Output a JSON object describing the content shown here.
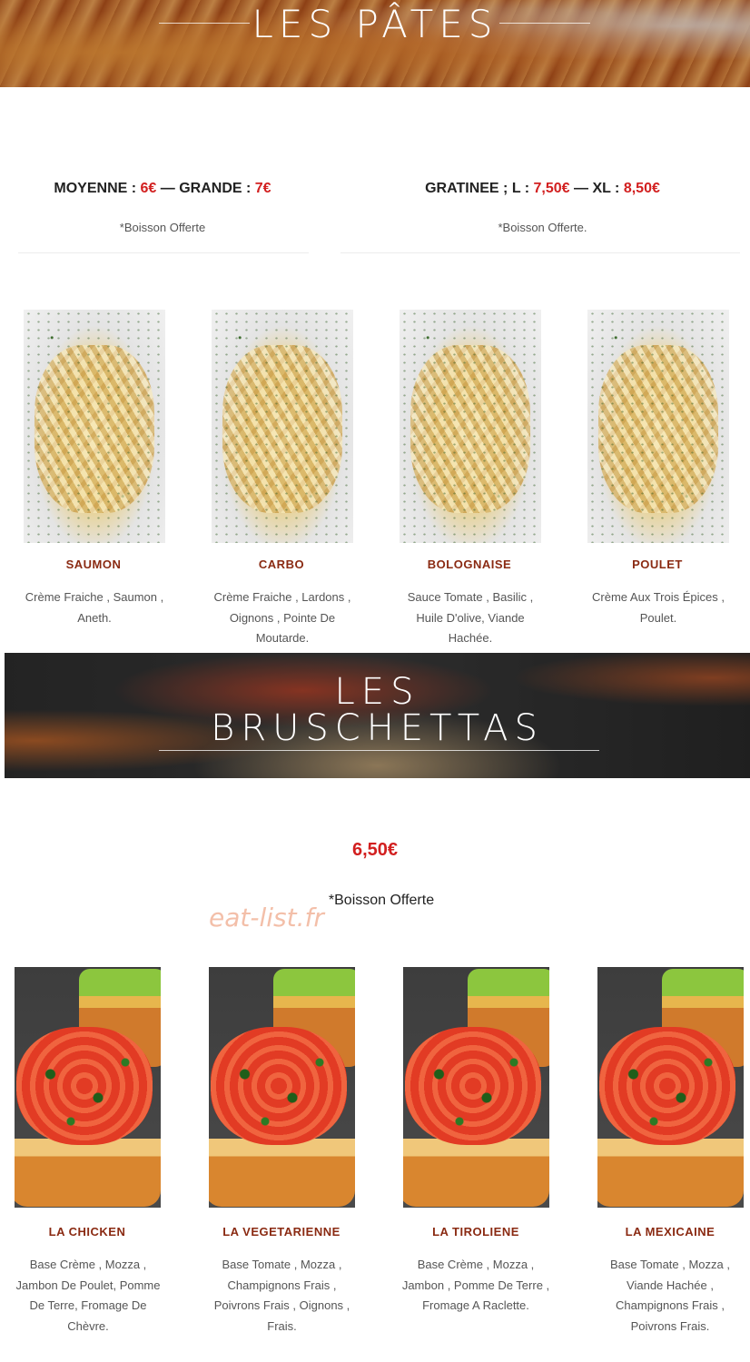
{
  "banners": {
    "pates": "LES PÂTES",
    "bruschettas_line1": "LES",
    "bruschettas_line2": "BRUSCHETTAS"
  },
  "pates_prices": {
    "left": {
      "moyenne_label": "MOYENNE : ",
      "moyenne_price": "6€",
      "sep": " — GRANDE : ",
      "grande_price": "7€",
      "note": "*Boisson Offerte"
    },
    "right": {
      "gratinee_label": "GRATINEE ; L : ",
      "l_price": "7,50€",
      "sep": " — XL : ",
      "xl_price": "8,50€",
      "note": "*Boisson Offerte."
    }
  },
  "pates": [
    {
      "name": "SAUMON",
      "desc": "Crème Fraiche , Saumon , Aneth."
    },
    {
      "name": "CARBO",
      "desc": "Crème Fraiche , Lardons , Oignons , Pointe De Moutarde."
    },
    {
      "name": "BOLOGNAISE",
      "desc": "Sauce Tomate , Basilic , Huile D'olive, Viande Hachée."
    },
    {
      "name": "POULET",
      "desc": "Crème Aux Trois Épices , Poulet."
    }
  ],
  "bruschettas_price": "6,50€",
  "bruschettas_note": "*Boisson Offerte",
  "watermark": "eat-list.fr",
  "bruschettas": [
    {
      "name": "LA CHICKEN",
      "desc": "Base Crème , Mozza , Jambon De Poulet, Pomme De Terre, Fromage De Chèvre."
    },
    {
      "name": "LA VEGETARIENNE",
      "desc": "Base Tomate , Mozza , Champignons Frais , Poivrons Frais , Oignons , Frais."
    },
    {
      "name": "LA TIROLIENE",
      "desc": "Base Crème , Mozza , Jambon , Pomme De Terre , Fromage A Raclette."
    },
    {
      "name": "LA MEXICAINE",
      "desc": "Base Tomate , Mozza , Viande Hachée , Champignons Frais , Poivrons Frais."
    }
  ],
  "colors": {
    "accent_red": "#d21f1f",
    "dish_title": "#8a2a12"
  }
}
